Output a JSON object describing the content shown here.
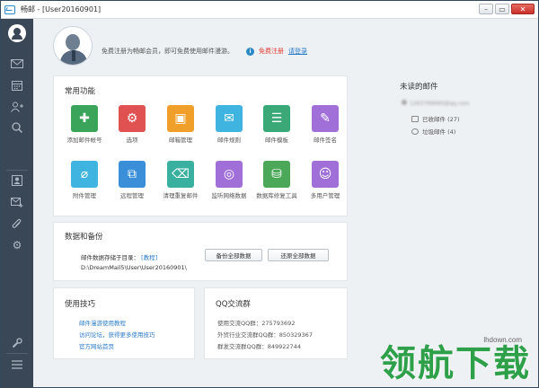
{
  "window": {
    "title": "畅邮 - [User20160901]",
    "controls": [
      "minimize",
      "restore",
      "close"
    ]
  },
  "sidebar": {
    "items": [
      {
        "name": "avatar-icon"
      },
      {
        "name": "mail-icon"
      },
      {
        "name": "calendar-icon"
      },
      {
        "name": "contacts-add-icon"
      },
      {
        "name": "search-icon"
      },
      {
        "name": "contact-card-icon"
      },
      {
        "name": "send-mail-icon"
      },
      {
        "name": "attachment-icon"
      },
      {
        "name": "settings-icon"
      },
      {
        "name": "tools-icon"
      },
      {
        "name": "menu-icon"
      }
    ]
  },
  "header": {
    "notice": "免费注册为畅邮会员，即可免费使用邮件漫游。",
    "register_label": "免费注册",
    "login_label": "请登录"
  },
  "functions": {
    "title": "常用功能",
    "items": [
      {
        "label": "添加邮件帐号",
        "color": "#3aa55a",
        "icon": "add-account-icon",
        "glyph": "✚"
      },
      {
        "label": "选项",
        "color": "#e05252",
        "icon": "options-gear-icon",
        "glyph": "⚙"
      },
      {
        "label": "邮箱管理",
        "color": "#f0a02a",
        "icon": "mailbox-manage-icon",
        "glyph": "▣"
      },
      {
        "label": "邮件规则",
        "color": "#3fb4e0",
        "icon": "mail-rules-icon",
        "glyph": "✉"
      },
      {
        "label": "邮件模板",
        "color": "#3aa877",
        "icon": "mail-template-icon",
        "glyph": "☰"
      },
      {
        "label": "邮件签名",
        "color": "#a070d8",
        "icon": "mail-signature-icon",
        "glyph": "✎"
      },
      {
        "label": "附件管理",
        "color": "#3fb4e0",
        "icon": "attachment-manage-icon",
        "glyph": "⌀"
      },
      {
        "label": "远程管理",
        "color": "#3a8fd8",
        "icon": "remote-manage-icon",
        "glyph": "⧉"
      },
      {
        "label": "清理重复邮件",
        "color": "#3ab0a0",
        "icon": "clean-duplicates-icon",
        "glyph": "⌫"
      },
      {
        "label": "监听网络数据",
        "color": "#a070d8",
        "icon": "monitor-network-icon",
        "glyph": "◎"
      },
      {
        "label": "数据库修复工具",
        "color": "#4aa858",
        "icon": "database-repair-icon",
        "glyph": "⛁"
      },
      {
        "label": "多用户管理",
        "color": "#a070d8",
        "icon": "multi-user-icon",
        "glyph": "☺"
      }
    ]
  },
  "backup": {
    "title": "数据和备份",
    "storage_label": "邮件数据存储于目录：",
    "tutorial_link": "[教程]",
    "path": "D:\\DreamMail5\\User\\User20160901\\",
    "backup_all": "备份全部数据",
    "restore_all": "还原全部数据"
  },
  "tips": {
    "title": "使用技巧",
    "links": [
      "邮件漫游使用教程",
      "访问论坛，获得更多使用技巧",
      "官方网站首页"
    ]
  },
  "qq": {
    "title": "QQ交流群",
    "lines": [
      "使用交流QQ群：275793692",
      "外贸行业交流群QQ群：850329367",
      "群发交流群QQ群：849922744"
    ]
  },
  "unread": {
    "title": "未读的邮件",
    "account": "1263769690@qq.com",
    "inbox": "已收邮件 (27)",
    "spam": "垃圾邮件 (4)"
  },
  "watermark": {
    "url": "lhdown.com",
    "text": "领航下载"
  }
}
